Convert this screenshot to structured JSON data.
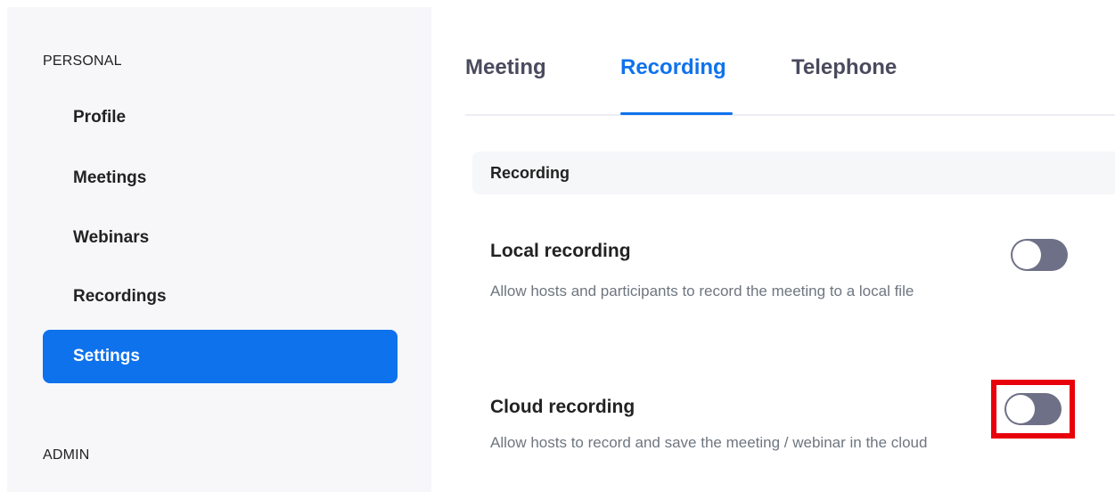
{
  "sidebar": {
    "personal_label": "PERSONAL",
    "items": [
      {
        "label": "Profile"
      },
      {
        "label": "Meetings"
      },
      {
        "label": "Webinars"
      },
      {
        "label": "Recordings"
      },
      {
        "label": "Settings"
      }
    ],
    "admin_label": "ADMIN"
  },
  "tabs": [
    {
      "label": "Meeting"
    },
    {
      "label": "Recording"
    },
    {
      "label": "Telephone"
    }
  ],
  "section": {
    "header": "Recording"
  },
  "settings": [
    {
      "title": "Local recording",
      "description": "Allow hosts and participants to record the meeting to a local file",
      "enabled": false
    },
    {
      "title": "Cloud recording",
      "description": "Allow hosts to record and save the meeting / webinar in the cloud",
      "enabled": false
    }
  ],
  "colors": {
    "accent": "#0e72ed",
    "toggle_off": "#6e7087",
    "highlight": "#e8000b"
  }
}
